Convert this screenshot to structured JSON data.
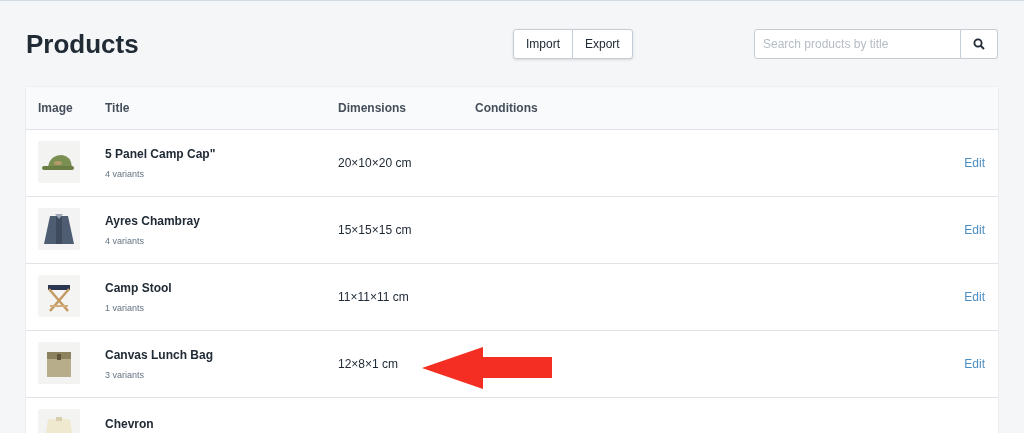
{
  "page_title": "Products",
  "actions": [
    "Import",
    "Export"
  ],
  "search": {
    "placeholder": "Search products by title"
  },
  "table": {
    "columns": [
      "Image",
      "Title",
      "Dimensions",
      "Conditions"
    ],
    "rows": [
      {
        "title": "5 Panel Camp Cap\"",
        "variants": "4 variants",
        "dimensions": "20×10×20 cm",
        "action": "Edit",
        "highlighted": false
      },
      {
        "title": "Ayres Chambray",
        "variants": "4 variants",
        "dimensions": "15×15×15 cm",
        "action": "Edit",
        "highlighted": false
      },
      {
        "title": "Camp Stool",
        "variants": "1 variants",
        "dimensions": "11×11×11 cm",
        "action": "Edit",
        "highlighted": false
      },
      {
        "title": "Canvas Lunch Bag",
        "variants": "3 variants",
        "dimensions": "12×8×1 cm",
        "action": "Edit",
        "highlighted": true
      },
      {
        "title": "Chevron",
        "highlighted": false
      }
    ]
  }
}
